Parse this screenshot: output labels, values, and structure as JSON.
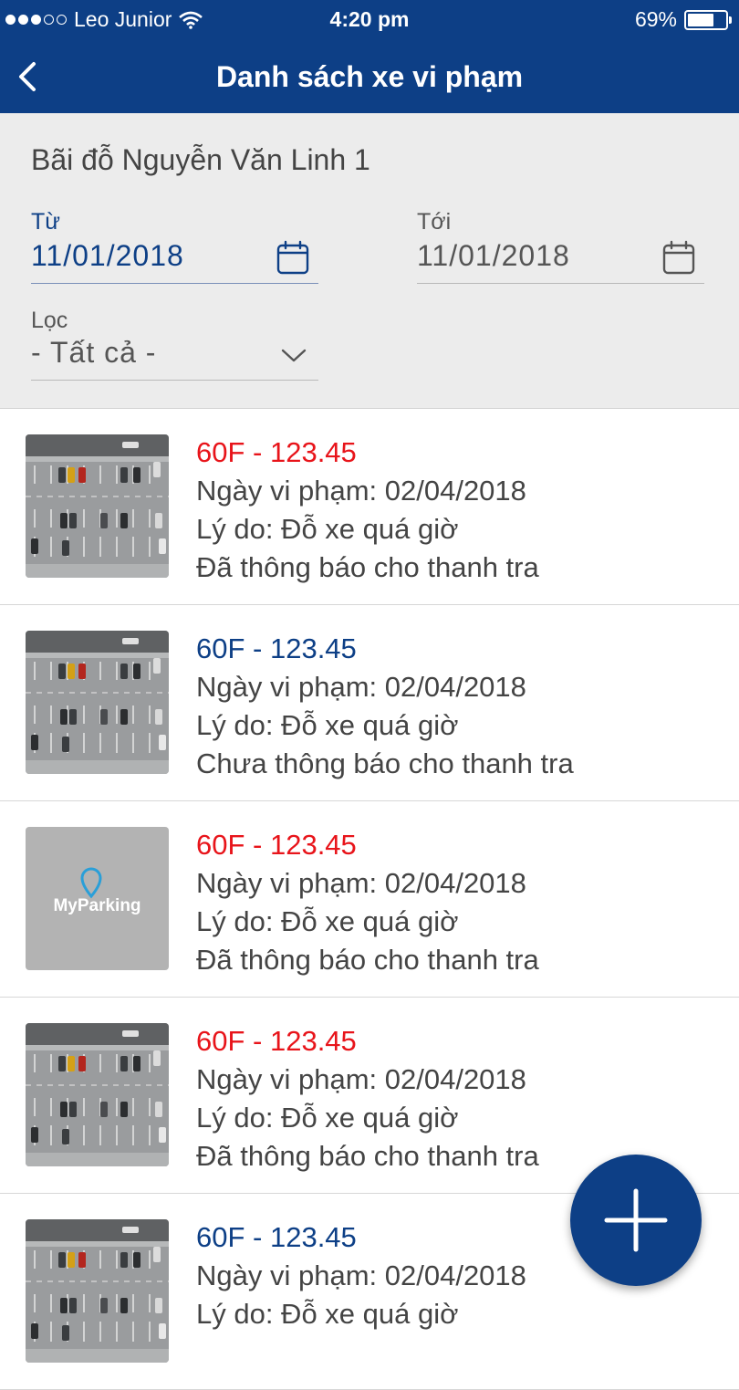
{
  "status_bar": {
    "carrier": "Leo Junior",
    "time": "4:20 pm",
    "battery": "69%",
    "battery_level": 0.69
  },
  "header": {
    "title": "Danh sách xe vi phạm",
    "back_icon": "chevron-left-icon"
  },
  "filters": {
    "lot_name": "Bãi đỗ Nguyễn Văn Linh 1",
    "from": {
      "label": "Từ",
      "value": "11/01/2018"
    },
    "to": {
      "label": "Tới",
      "value": "11/01/2018"
    },
    "filter": {
      "label": "Lọc",
      "value": "- Tất cả -"
    }
  },
  "violations": [
    {
      "plate": "60F - 123.45",
      "plate_color": "#e8141a",
      "date": "Ngày vi phạm: 02/04/2018",
      "reason": "Lý do: Đỗ xe quá giờ",
      "status": "Đã thông báo cho thanh tra",
      "thumbnail": "parking-photo"
    },
    {
      "plate": "60F - 123.45",
      "plate_color": "#0d3f86",
      "date": "Ngày vi phạm: 02/04/2018",
      "reason": "Lý do: Đỗ xe quá giờ",
      "status": "Chưa thông báo cho thanh tra",
      "thumbnail": "parking-photo"
    },
    {
      "plate": "60F - 123.45",
      "plate_color": "#e8141a",
      "date": "Ngày vi phạm: 02/04/2018",
      "reason": "Lý do: Đỗ xe quá giờ",
      "status": "Đã thông báo cho thanh tra",
      "thumbnail": "myparking-logo",
      "logo_text": "MyParking"
    },
    {
      "plate": "60F - 123.45",
      "plate_color": "#e8141a",
      "date": "Ngày vi phạm: 02/04/2018",
      "reason": "Lý do: Đỗ xe quá giờ",
      "status": "Đã thông báo cho thanh tra",
      "thumbnail": "parking-photo"
    },
    {
      "plate": "60F - 123.45",
      "plate_color": "#0d3f86",
      "date": "Ngày vi phạm: 02/04/2018",
      "reason": "Lý do: Đỗ xe quá giờ",
      "status": "",
      "thumbnail": "parking-photo"
    }
  ],
  "fab": {
    "icon": "plus-icon"
  },
  "colors": {
    "primary": "#0d3f86",
    "notified": "#e8141a",
    "filter_bg": "#ececec"
  }
}
